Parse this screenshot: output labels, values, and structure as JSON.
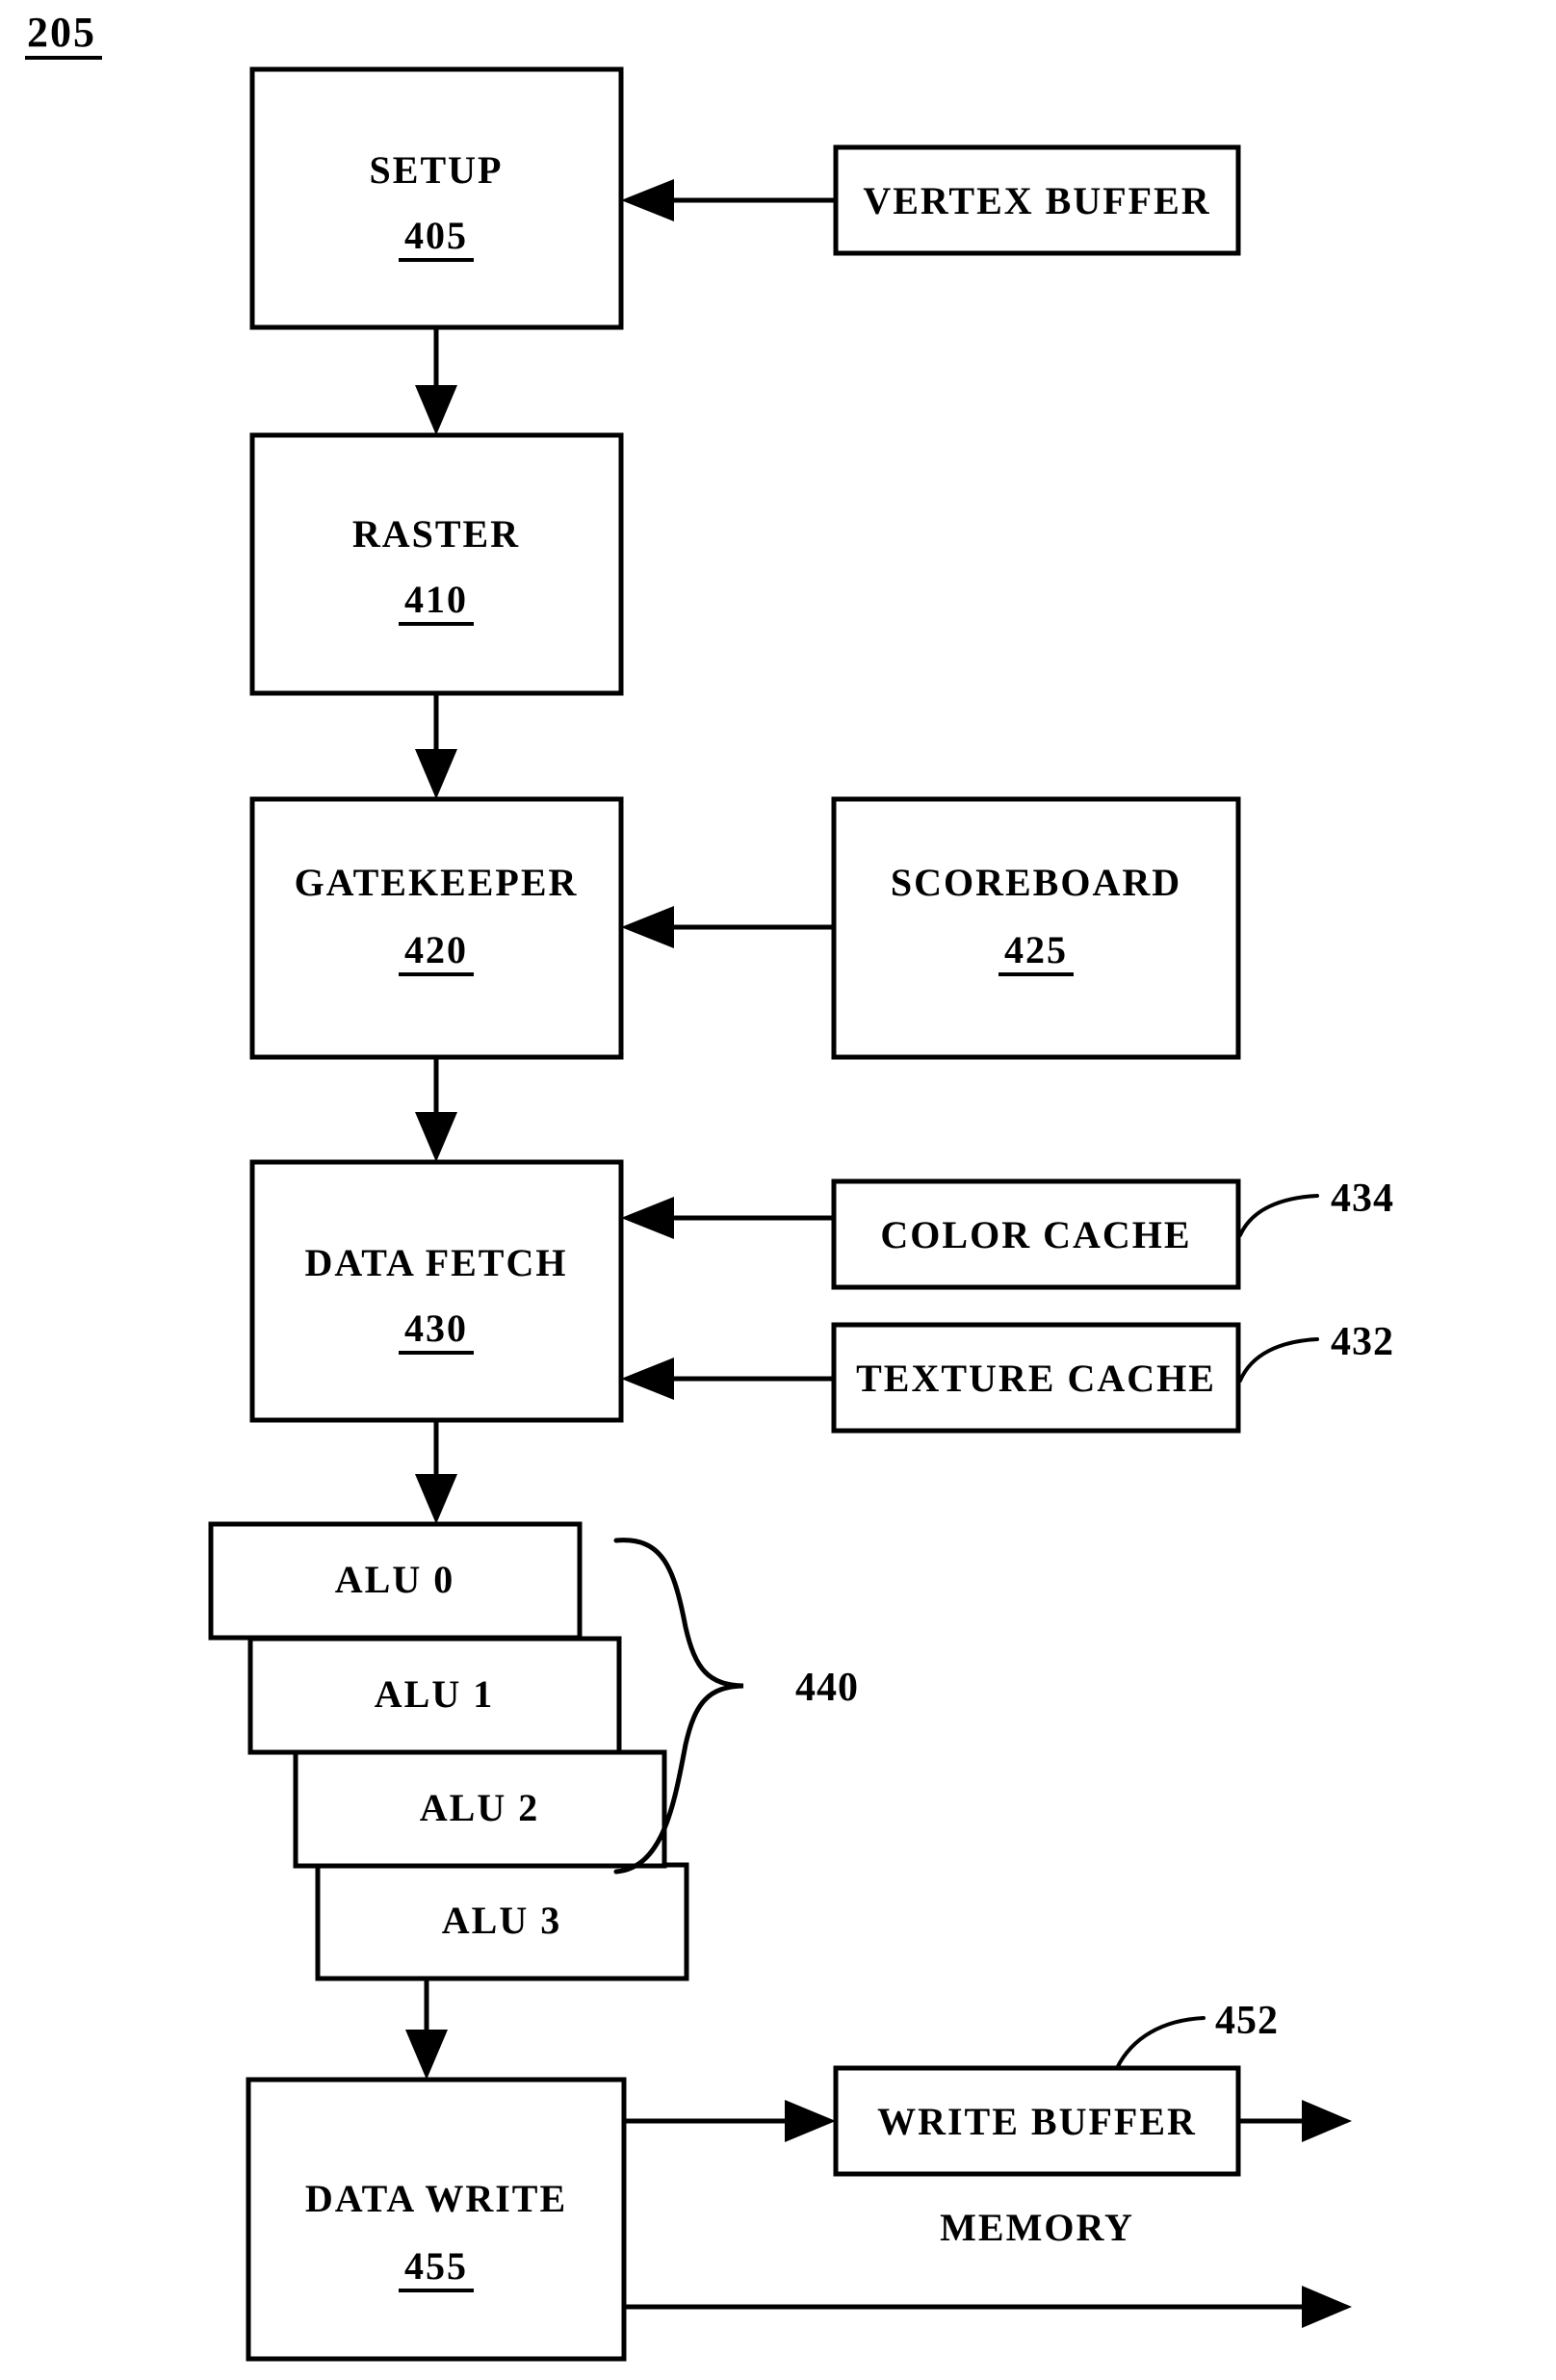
{
  "figure": {
    "number": "205",
    "type": "block-diagram",
    "title": "Graphics pipeline block diagram"
  },
  "blocks": [
    {
      "id": "setup",
      "label": "SETUP",
      "ref": "405"
    },
    {
      "id": "vertex_buffer",
      "label": "VERTEX BUFFER",
      "ref": ""
    },
    {
      "id": "raster",
      "label": "RASTER",
      "ref": "410"
    },
    {
      "id": "gatekeeper",
      "label": "GATEKEEPER",
      "ref": "420"
    },
    {
      "id": "scoreboard",
      "label": "SCOREBOARD",
      "ref": "425"
    },
    {
      "id": "data_fetch",
      "label": "DATA FETCH",
      "ref": "430"
    },
    {
      "id": "color_cache",
      "label": "COLOR CACHE",
      "ref": ""
    },
    {
      "id": "texture_cache",
      "label": "TEXTURE CACHE",
      "ref": ""
    },
    {
      "id": "alu0",
      "label": "ALU 0",
      "ref": ""
    },
    {
      "id": "alu1",
      "label": "ALU 1",
      "ref": ""
    },
    {
      "id": "alu2",
      "label": "ALU 2",
      "ref": ""
    },
    {
      "id": "alu3",
      "label": "ALU 3",
      "ref": ""
    },
    {
      "id": "data_write",
      "label": "DATA WRITE",
      "ref": "455"
    },
    {
      "id": "write_buffer",
      "label": "WRITE BUFFER",
      "ref": ""
    }
  ],
  "callouts": [
    {
      "id": "color_cache_ref",
      "text": "434",
      "target": "color_cache"
    },
    {
      "id": "texture_cache_ref",
      "text": "432",
      "target": "texture_cache"
    },
    {
      "id": "alu_group_ref",
      "text": "440",
      "target": "alu-stack"
    },
    {
      "id": "write_buffer_ref",
      "text": "452",
      "target": "write_buffer"
    }
  ],
  "annotations": [
    {
      "id": "memory_label",
      "text": "MEMORY"
    }
  ],
  "connections": [
    {
      "from": "vertex_buffer",
      "to": "setup",
      "style": "arrow-left"
    },
    {
      "from": "setup",
      "to": "raster",
      "style": "arrow-down"
    },
    {
      "from": "raster",
      "to": "gatekeeper",
      "style": "arrow-down"
    },
    {
      "from": "scoreboard",
      "to": "gatekeeper",
      "style": "arrow-left"
    },
    {
      "from": "gatekeeper",
      "to": "data_fetch",
      "style": "arrow-down"
    },
    {
      "from": "color_cache",
      "to": "data_fetch",
      "style": "arrow-left"
    },
    {
      "from": "texture_cache",
      "to": "data_fetch",
      "style": "arrow-left"
    },
    {
      "from": "data_fetch",
      "to": "alu0",
      "style": "arrow-down"
    },
    {
      "from": "alu3",
      "to": "data_write",
      "style": "arrow-down"
    },
    {
      "from": "data_write",
      "to": "write_buffer",
      "style": "arrow-right"
    },
    {
      "from": "write_buffer",
      "to": "memory",
      "style": "arrow-right-open"
    },
    {
      "from": "data_write",
      "to": "memory",
      "style": "arrow-right-open"
    }
  ],
  "colors": {
    "ink": "#000000",
    "paper": "#ffffff"
  }
}
